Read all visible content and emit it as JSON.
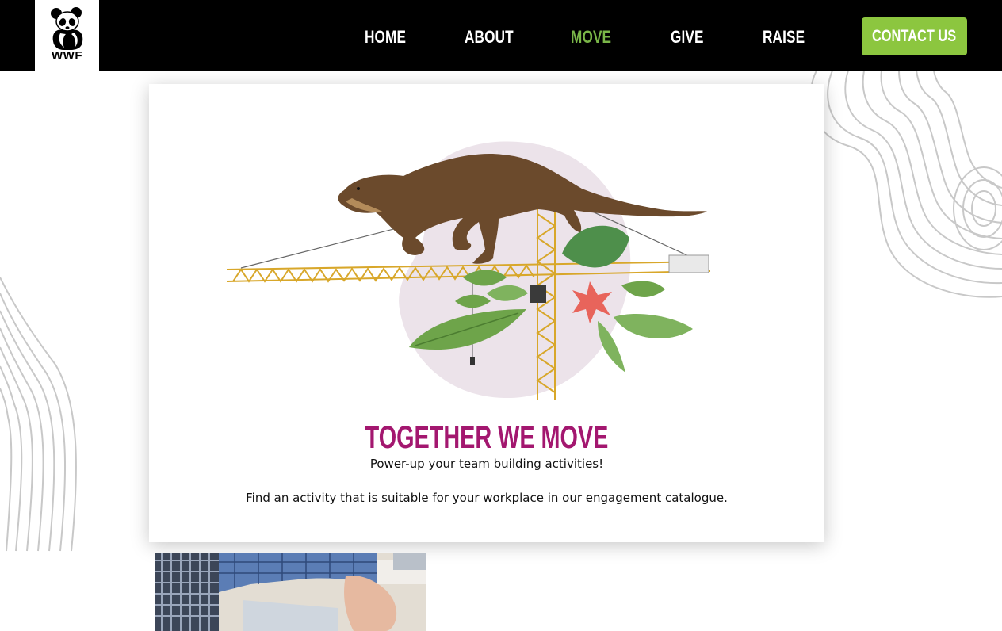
{
  "header": {
    "logo_text": "WWF",
    "nav": [
      {
        "label": "HOME",
        "active": false
      },
      {
        "label": "ABOUT",
        "active": false
      },
      {
        "label": "MOVE",
        "active": true
      },
      {
        "label": "GIVE",
        "active": false
      },
      {
        "label": "RAISE",
        "active": false
      }
    ],
    "contact_label": "CONTACT US"
  },
  "card": {
    "title": "TOGETHER WE MOVE",
    "subtitle": "Power-up your team building activities!",
    "description": "Find an activity that is suitable for your workplace in our engagement catalogue."
  },
  "icons": [
    "panda-logo-icon"
  ],
  "colors": {
    "header_bg": "#000000",
    "nav_text": "#ffffff",
    "nav_active": "#7ab648",
    "contact_bg": "#8cc63f",
    "title": "#a3176f",
    "body_text": "#111111"
  }
}
